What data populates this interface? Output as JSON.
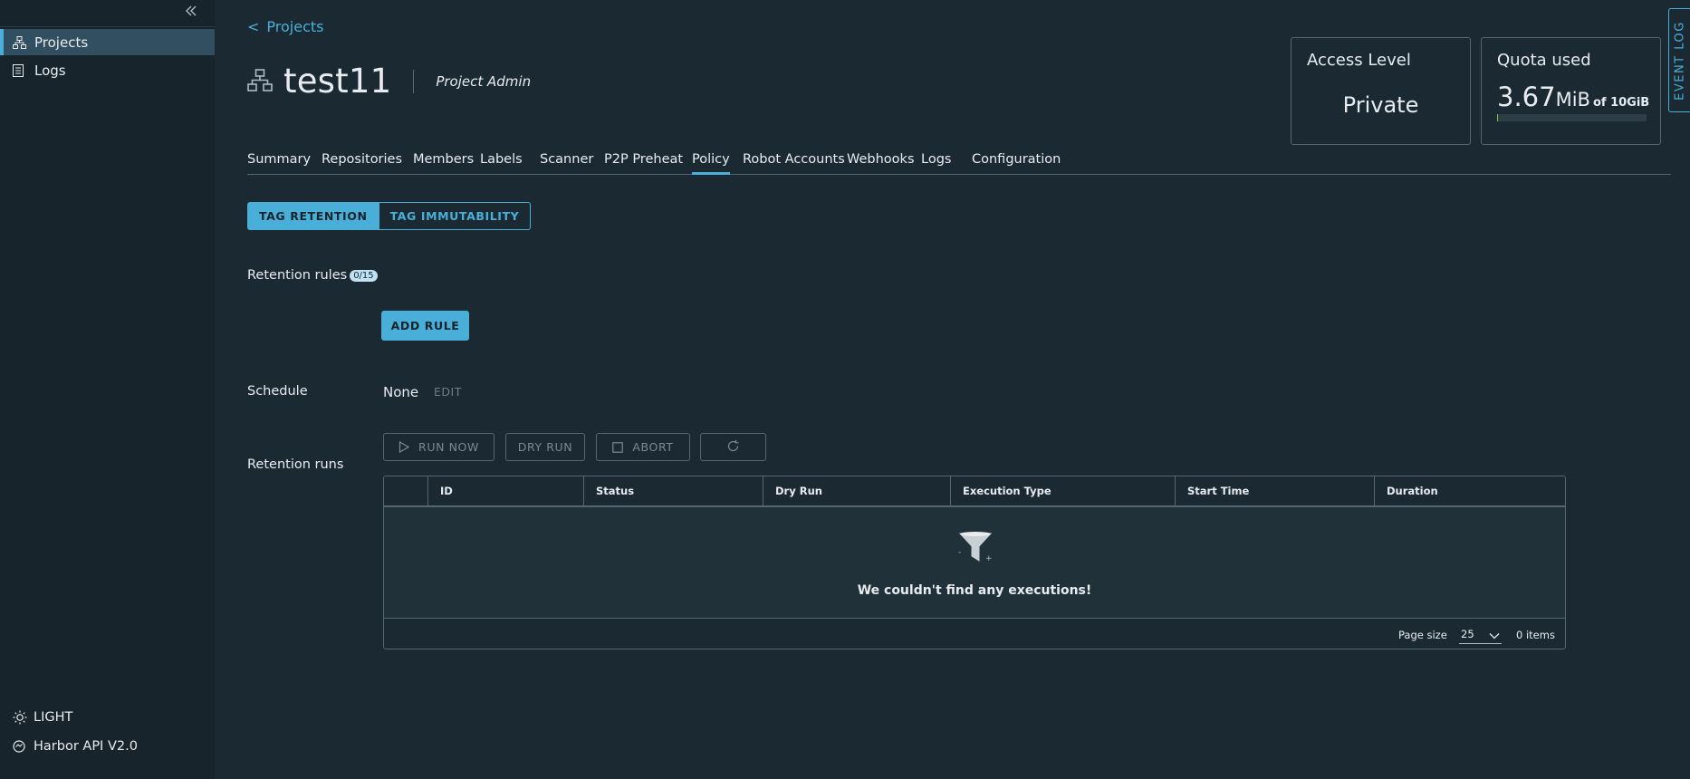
{
  "sidebar": {
    "items": [
      {
        "label": "Projects",
        "icon": "projects-icon",
        "active": true
      },
      {
        "label": "Logs",
        "icon": "logs-icon",
        "active": false
      }
    ],
    "footer": {
      "theme_label": "LIGHT",
      "api_label": "Harbor API V2.0"
    }
  },
  "breadcrumb": {
    "label": "Projects"
  },
  "project": {
    "name": "test11",
    "role": "Project Admin"
  },
  "cards": {
    "access": {
      "title": "Access Level",
      "value": "Private"
    },
    "quota": {
      "title": "Quota used",
      "used_number": "3.67",
      "used_unit": "MiB",
      "of_text": "of 10GiB",
      "fraction": 0.00036
    }
  },
  "event_log": {
    "label": "EVENT LOG"
  },
  "tabs": [
    {
      "label": "Summary"
    },
    {
      "label": "Repositories"
    },
    {
      "label": "Members"
    },
    {
      "label": "Labels"
    },
    {
      "label": "Scanner"
    },
    {
      "label": "P2P Preheat"
    },
    {
      "label": "Policy",
      "active": true
    },
    {
      "label": "Robot Accounts"
    },
    {
      "label": "Webhooks"
    },
    {
      "label": "Logs"
    },
    {
      "label": "Configuration"
    }
  ],
  "policy_tabs": {
    "retention": "TAG RETENTION",
    "immutability": "TAG IMMUTABILITY"
  },
  "retention_rules": {
    "label": "Retention rules",
    "count": "0/15",
    "add_button": "ADD RULE"
  },
  "schedule": {
    "label": "Schedule",
    "value": "None",
    "edit": "EDIT"
  },
  "retention_runs": {
    "label": "Retention runs",
    "buttons": {
      "run_now": "RUN NOW",
      "dry_run": "DRY RUN",
      "abort": "ABORT"
    },
    "columns": [
      "ID",
      "Status",
      "Dry Run",
      "Execution Type",
      "Start Time",
      "Duration"
    ],
    "empty_text": "We couldn't find any executions!",
    "page_size_label": "Page size",
    "page_size": "25",
    "items_text": "0 items"
  },
  "colors": {
    "accent": "#49afd9",
    "background": "#1b2a32",
    "sidebar": "#17242b",
    "quota_fill": "#6fce3c"
  }
}
